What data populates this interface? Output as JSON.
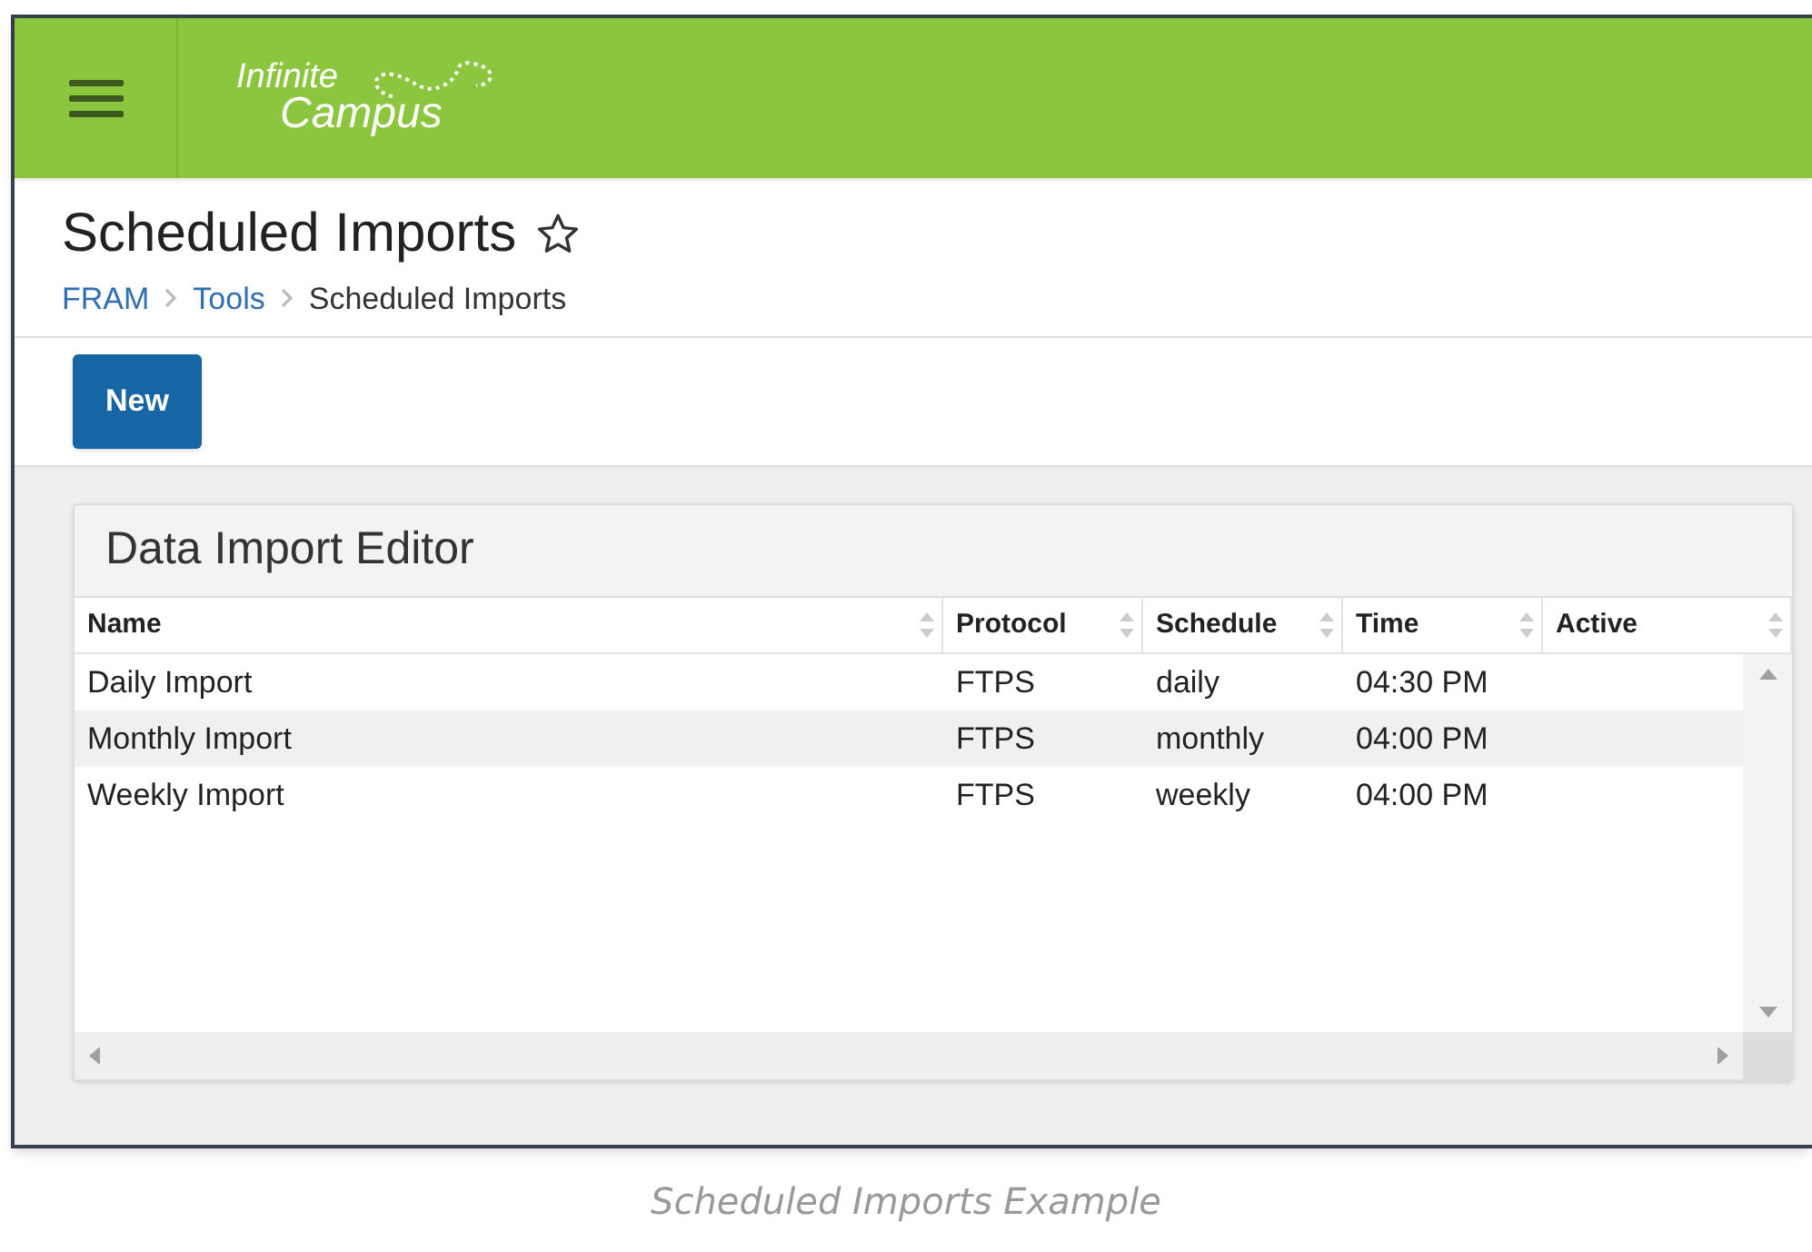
{
  "header": {
    "logo": {
      "line_1": "Infinite",
      "line_2": "Campus"
    }
  },
  "page": {
    "title": "Scheduled Imports",
    "favorite": false,
    "breadcrumb": [
      {
        "label": "FRAM",
        "kind": "link"
      },
      {
        "label": "Tools",
        "kind": "link"
      },
      {
        "label": "Scheduled Imports",
        "kind": "current"
      }
    ]
  },
  "toolbar": {
    "buttons": [
      "New"
    ]
  },
  "panel": {
    "title": "Data Import Editor",
    "table": {
      "columns": [
        "Name",
        "Protocol",
        "Schedule",
        "Time",
        "Active"
      ],
      "rows": [
        [
          "Daily Import",
          "FTPS",
          "daily",
          "04:30 PM",
          ""
        ],
        [
          "Monthly Import",
          "FTPS",
          "monthly",
          "04:00 PM",
          ""
        ],
        [
          "Weekly Import",
          "FTPS",
          "weekly",
          "04:00 PM",
          ""
        ]
      ]
    }
  },
  "caption": "Scheduled Imports Example"
}
